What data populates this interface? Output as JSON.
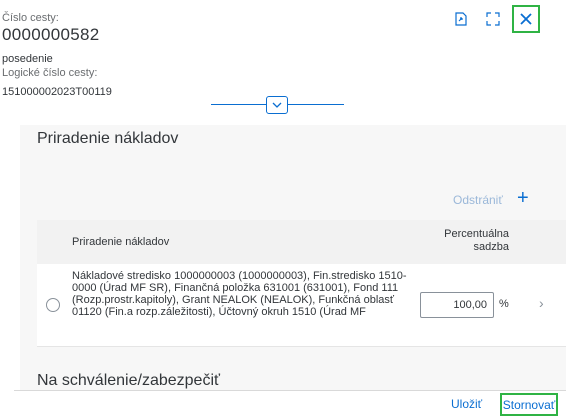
{
  "header": {
    "trip_number_label": "Číslo cesty:",
    "trip_number": "0000000582",
    "status": "posedenie",
    "logical_number_label": "Logické číslo cesty:",
    "logical_number": "151000002023T00119"
  },
  "section": {
    "title": "Priradenie nákladov",
    "remove_label": "Odstrániť",
    "add_label": "+"
  },
  "table": {
    "columns": [
      "Priradenie nákladov",
      "Percentuálna sadzba"
    ],
    "rows": [
      {
        "assignment": "Nákladové stredisko 1000000003 (1000000003), Fin.stredisko 1510-0000 (Úrad MF SR), Finančná položka 631001 (631001), Fond 111 (Rozp.prostr.kapitoly), Grant NEALOK (NEALOK), Funkčná oblasť 01120 (Fin.a rozp.záležitosti), Účtovný okruh 1510 (Úrad MF",
        "percentage": "100,00",
        "unit": "%"
      }
    ]
  },
  "next_section": {
    "title": "Na schválenie/zabezpečiť"
  },
  "footer": {
    "save_label": "Uložiť",
    "cancel_label": "Stornovať"
  },
  "colors": {
    "accent": "#0a6ed1",
    "highlight": "#2fb344"
  },
  "icons": [
    "pin-icon",
    "fullscreen-icon",
    "close-icon",
    "chevron-down-icon",
    "chevron-right-icon"
  ]
}
